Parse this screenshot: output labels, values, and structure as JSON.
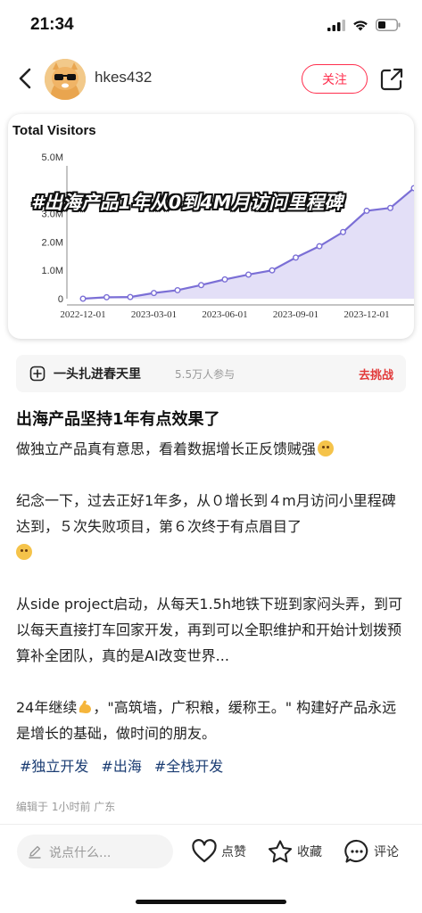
{
  "status": {
    "time": "21:34"
  },
  "header": {
    "username": "hkes432",
    "follow_label": "关注"
  },
  "chart_overlay_text": "#出海产品1年从0到4M月访问里程碑",
  "chart_data": {
    "type": "area",
    "title": "Total Visitors",
    "x": [
      "2022-12-01",
      "2023-01-01",
      "2023-02-01",
      "2023-03-01",
      "2023-04-01",
      "2023-05-01",
      "2023-06-01",
      "2023-07-01",
      "2023-08-01",
      "2023-09-01",
      "2023-10-01",
      "2023-11-01",
      "2023-12-01",
      "2024-01-01",
      "2024-02-01"
    ],
    "series": [
      {
        "values": [
          0,
          0.05,
          0.06,
          0.2,
          0.3,
          0.48,
          0.68,
          0.85,
          1.0,
          1.45,
          1.85,
          2.35,
          3.1,
          3.2,
          3.9
        ]
      }
    ],
    "y_unit": "M",
    "ylim": [
      0,
      5
    ],
    "y_ticks": [
      "0",
      "1.0M",
      "2.0M",
      "3.0M",
      "5.0M"
    ],
    "x_ticks": [
      "2022-12-01",
      "2023-03-01",
      "2023-06-01",
      "2023-09-01",
      "2023-12-01"
    ],
    "grid": false,
    "colors": {
      "line": "#7b6fd6",
      "fill": "#d9d4f4"
    }
  },
  "challenge": {
    "title": "一头扎进春天里",
    "count": "5.5万人参与",
    "action": "去挑战"
  },
  "post": {
    "title": "出海产品坚持1年有点效果了",
    "p1": "做独立产品真有意思，看着数据增长正反馈贼强",
    "p2": "纪念一下，过去正好1年多，从０增长到４m月访问小里程碑达到，５次失败项目，第６次终于有点眉目了",
    "p3": "从side project启动，从每天1.5h地铁下班到家闷头弄，到可以每天直接打车回家开发，再到可以全职维护和开始计划拨预算补全团队，真的是AI改变世界...",
    "p4a": "24年继续",
    "p4b": "，\"高筑墙，广积粮，缓称王。\" 构建好产品永远是增长的基础，做时间的朋友。",
    "tags": [
      "#独立开发",
      "#出海",
      "#全栈开发"
    ],
    "edit_meta": "编辑于 1小时前 广东"
  },
  "bottom": {
    "comment_placeholder": "说点什么...",
    "like_label": "点赞",
    "collect_label": "收藏",
    "comment_label": "评论"
  }
}
